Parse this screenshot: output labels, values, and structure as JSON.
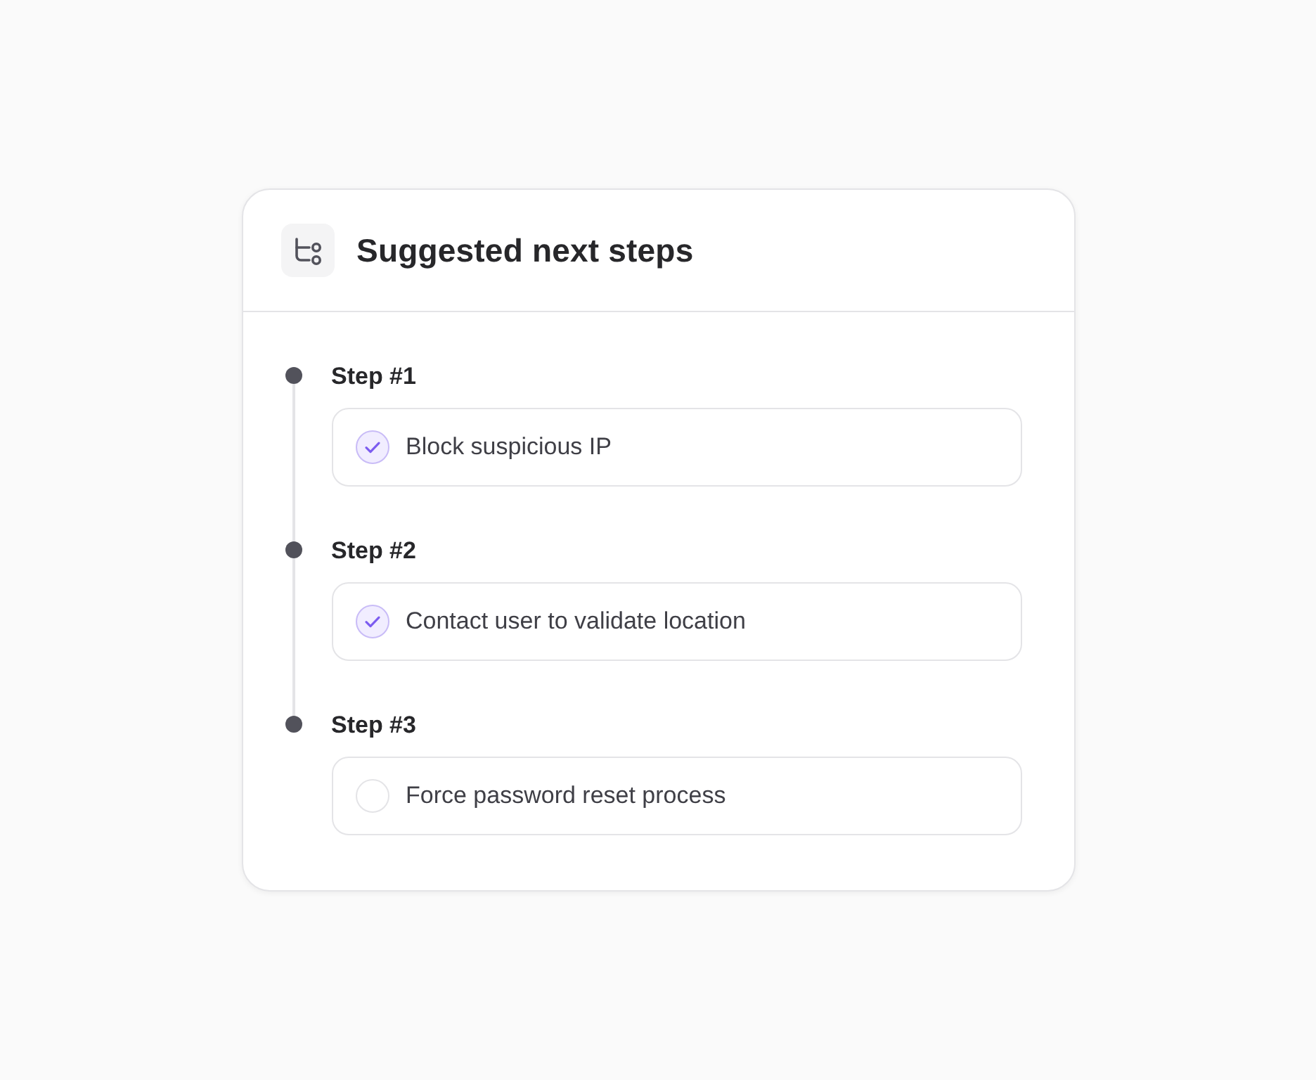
{
  "card": {
    "title": "Suggested next steps"
  },
  "steps": [
    {
      "label": "Step #1",
      "task": "Block suspicious IP",
      "checked": true
    },
    {
      "label": "Step #2",
      "task": "Contact user to validate location",
      "checked": true
    },
    {
      "label": "Step #3",
      "task": "Force password reset process",
      "checked": false
    }
  ]
}
